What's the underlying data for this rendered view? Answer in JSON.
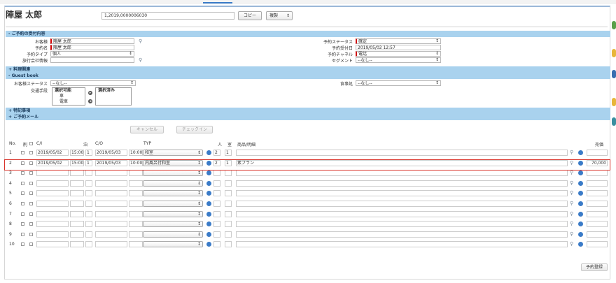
{
  "header": {
    "title": "陣屋 太郎",
    "id_value": "1,2019,0000006030",
    "copy_label": "コピー",
    "duplicate_label": "複製"
  },
  "sections": {
    "reservation_info": "ご予約の受付内容",
    "cuisine": "料理関連",
    "guest_book": "Guest book",
    "special_notes": "特記事項",
    "reservation_memo": "ご予約メール"
  },
  "form": {
    "guest_label": "お客様",
    "guest_value": "陣屋 太郎",
    "reserver_label": "予約名",
    "reserver_value": "陣屋 太郎",
    "type_label": "予約タイプ",
    "type_value": "個人",
    "agency_label": "旅行会社情報",
    "status_label": "予約ステータス",
    "status_value": "確定",
    "received_label": "予約受付日",
    "received_value": "2019/05/02 12:57",
    "channel_label": "予約チャネル",
    "channel_value": "電話",
    "segment_label": "セグメント",
    "segment_value": "--なし--",
    "guestbook_status_label": "お客様ステータス",
    "guestbook_status_value": "--なし--",
    "transport_label": "交通手段",
    "transport_available_header": "選択可能",
    "transport_available": [
      "車",
      "電車"
    ],
    "transport_selected_header": "選択済み",
    "meal_place_label": "食事処",
    "meal_place_value": "--なし--"
  },
  "actions": {
    "cancel_label": "キャンセル",
    "checkin_label": "チェックイン",
    "register_label": "予約登録"
  },
  "grid": {
    "headers": {
      "no": "No.",
      "del": "削",
      "ci": "C/I",
      "night": "泊",
      "co": "C/O",
      "type": "TYP",
      "people": "人",
      "room": "室",
      "product": "商品/明細",
      "amount": "売価"
    },
    "rows": [
      {
        "no": "1",
        "ci": "2019/05/02",
        "ci_time": "15:00",
        "nights": "1",
        "co": "2019/05/03",
        "co_time": "10:00",
        "type": "和室",
        "people": "2",
        "rooms": "1",
        "product": "",
        "amount": ""
      },
      {
        "no": "2",
        "ci": "2019/05/02",
        "ci_time": "15:00",
        "nights": "1",
        "co": "2019/05/03",
        "co_time": "10:00",
        "type": "内風呂付和室",
        "people": "2",
        "rooms": "1",
        "product": "素プラン",
        "amount": "70,000"
      },
      {
        "no": "3",
        "ci": "",
        "ci_time": "",
        "nights": "",
        "co": "",
        "co_time": "",
        "type": "",
        "people": "",
        "rooms": "",
        "product": "",
        "amount": ""
      },
      {
        "no": "4",
        "ci": "",
        "ci_time": "",
        "nights": "",
        "co": "",
        "co_time": "",
        "type": "",
        "people": "",
        "rooms": "",
        "product": "",
        "amount": ""
      },
      {
        "no": "5",
        "ci": "",
        "ci_time": "",
        "nights": "",
        "co": "",
        "co_time": "",
        "type": "",
        "people": "",
        "rooms": "",
        "product": "",
        "amount": ""
      },
      {
        "no": "6",
        "ci": "",
        "ci_time": "",
        "nights": "",
        "co": "",
        "co_time": "",
        "type": "",
        "people": "",
        "rooms": "",
        "product": "",
        "amount": ""
      },
      {
        "no": "7",
        "ci": "",
        "ci_time": "",
        "nights": "",
        "co": "",
        "co_time": "",
        "type": "",
        "people": "",
        "rooms": "",
        "product": "",
        "amount": ""
      },
      {
        "no": "8",
        "ci": "",
        "ci_time": "",
        "nights": "",
        "co": "",
        "co_time": "",
        "type": "",
        "people": "",
        "rooms": "",
        "product": "",
        "amount": ""
      },
      {
        "no": "9",
        "ci": "",
        "ci_time": "",
        "nights": "",
        "co": "",
        "co_time": "",
        "type": "",
        "people": "",
        "rooms": "",
        "product": "",
        "amount": ""
      },
      {
        "no": "10",
        "ci": "",
        "ci_time": "",
        "nights": "",
        "co": "",
        "co_time": "",
        "type": "",
        "people": "",
        "rooms": "",
        "product": "",
        "amount": ""
      }
    ]
  },
  "colors": {
    "section_bar": "#a9d2ee",
    "accent": "#3a7bc8",
    "highlight_border": "#d9342b",
    "required_marker": "#d00000"
  }
}
